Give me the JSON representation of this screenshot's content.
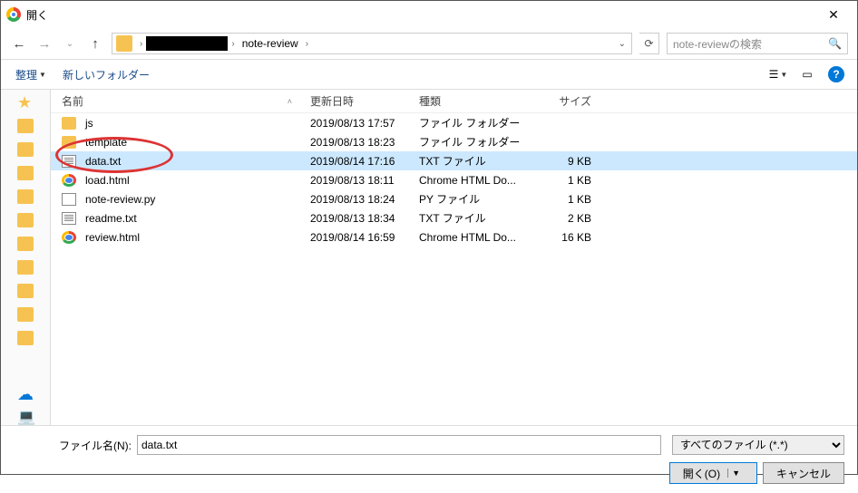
{
  "title": "開く",
  "breadcrumb": {
    "current": "note-review"
  },
  "search": {
    "placeholder": "note-reviewの検索"
  },
  "toolbar": {
    "organize": "整理",
    "newfolder": "新しいフォルダー"
  },
  "columns": {
    "name": "名前",
    "date": "更新日時",
    "type": "種類",
    "size": "サイズ"
  },
  "files": [
    {
      "name": "js",
      "date": "2019/08/13 17:57",
      "type": "ファイル フォルダー",
      "size": "",
      "icon": "folder"
    },
    {
      "name": "template",
      "date": "2019/08/13 18:23",
      "type": "ファイル フォルダー",
      "size": "",
      "icon": "folder"
    },
    {
      "name": "data.txt",
      "date": "2019/08/14 17:16",
      "type": "TXT ファイル",
      "size": "9 KB",
      "icon": "txt",
      "selected": true
    },
    {
      "name": "load.html",
      "date": "2019/08/13 18:11",
      "type": "Chrome HTML Do...",
      "size": "1 KB",
      "icon": "chrome"
    },
    {
      "name": "note-review.py",
      "date": "2019/08/13 18:24",
      "type": "PY ファイル",
      "size": "1 KB",
      "icon": "py"
    },
    {
      "name": "readme.txt",
      "date": "2019/08/13 18:34",
      "type": "TXT ファイル",
      "size": "2 KB",
      "icon": "txt"
    },
    {
      "name": "review.html",
      "date": "2019/08/14 16:59",
      "type": "Chrome HTML Do...",
      "size": "16 KB",
      "icon": "chrome"
    }
  ],
  "filename": {
    "label": "ファイル名(N):",
    "value": "data.txt"
  },
  "filter": {
    "value": "すべてのファイル (*.*)"
  },
  "buttons": {
    "open": "開く(O)",
    "cancel": "キャンセル"
  }
}
